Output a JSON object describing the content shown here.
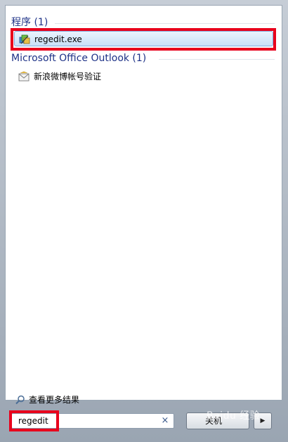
{
  "start_menu": {
    "groups": [
      {
        "header": "程序 (1)",
        "items": [
          {
            "label": "regedit.exe",
            "icon": "regedit-icon",
            "selected": true
          }
        ]
      },
      {
        "header": "Microsoft Office Outlook (1)",
        "items": [
          {
            "label": "新浪微博帐号验证",
            "icon": "mail-icon",
            "selected": false
          }
        ]
      }
    ],
    "see_more": "查看更多结果",
    "search": {
      "value": "regedit",
      "clear_symbol": "×"
    },
    "shutdown": {
      "label": "关机",
      "arrow": "▶"
    },
    "watermark": "Baidu 经验",
    "annotation_color": "#e8001c"
  }
}
